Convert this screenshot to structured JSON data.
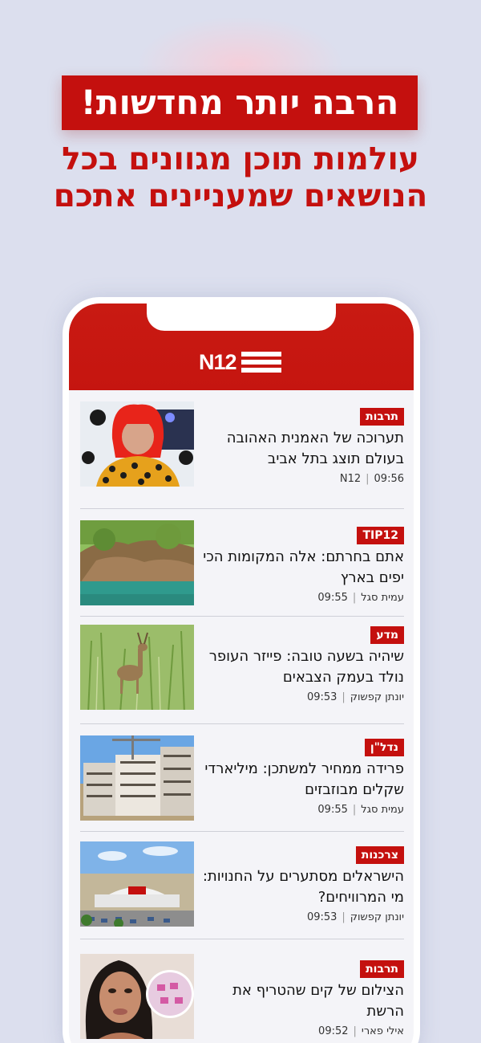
{
  "promo": {
    "headline": "הרבה יותר מחדשות!",
    "subline_1": "עולמות תוכן מגוונים בכל",
    "subline_2": "הנושאים שמעניינים אתכם"
  },
  "app": {
    "logo_text": "N12"
  },
  "colors": {
    "brand_red": "#c4100e",
    "background": "#dcdfee"
  },
  "feed": [
    {
      "tag": "תרבות",
      "title": "תערוכה של האמנית האהובה בעולם תוצג בתל אביב",
      "author": "N12",
      "time": "09:56"
    },
    {
      "tag": "TIP12",
      "title": "אתם בחרתם: אלה המקומות הכי יפים בארץ",
      "author": "עמית סגל",
      "time": "09:55"
    },
    {
      "tag": "מדע",
      "title": "שיהיה בשעה טובה: פייזר העופר נולד בעמק הצבאים",
      "author": "יונתן קפשוק",
      "time": "09:53"
    },
    {
      "tag": "נדל\"ן",
      "title": "פרידה ממחיר למשתכן: מיליארדי שקלים מבוזבזים",
      "author": "עמית סגל",
      "time": "09:55"
    },
    {
      "tag": "צרכנות",
      "title": "הישראלים מסתערים על החנויות: מי המרוויחים?",
      "author": "יונתן קפשוק",
      "time": "09:53"
    },
    {
      "tag": "תרבות",
      "title": "הצילום של קים שהטריף את הרשת",
      "author": "אילי פארי",
      "time": "09:52"
    }
  ]
}
